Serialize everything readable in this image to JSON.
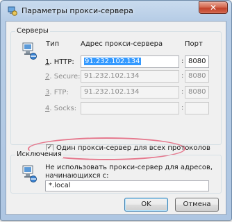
{
  "window": {
    "title": "Параметры прокси-сервера",
    "close_glyph": "✕",
    "accent_color": "#b7cde6",
    "close_color": "#c2432b"
  },
  "servers": {
    "group_label": "Серверы",
    "col_type": "Тип",
    "col_address": "Адрес прокси-сервера",
    "col_port": "Порт",
    "icon": "network-computer-icon",
    "rows": [
      {
        "key": "1",
        "label": ". HTTP:",
        "address": "91.232.102.134",
        "port": "8080",
        "enabled": true
      },
      {
        "key": "2",
        "label": ". Secure:",
        "address": "91.232.102.134",
        "port": "8080",
        "enabled": false
      },
      {
        "key": "3",
        "label": ". FTP:",
        "address": "91.232.102.134",
        "port": "8080",
        "enabled": false
      },
      {
        "key": "4",
        "label": ". Socks:",
        "address": "",
        "port": "",
        "enabled": false
      }
    ],
    "same_proxy_label": "Один прокси-сервер для всех протоколов",
    "same_proxy_checked": true,
    "highlight_color": "#e46b83"
  },
  "exceptions": {
    "group_label": "Исключения",
    "icon": "network-computer-icon",
    "description_line1": "Не использовать прокси-сервер для адресов,",
    "description_line2": "начинающихся с:",
    "value": "*.local"
  },
  "buttons": {
    "ok": "OK",
    "cancel": "Отмена"
  }
}
